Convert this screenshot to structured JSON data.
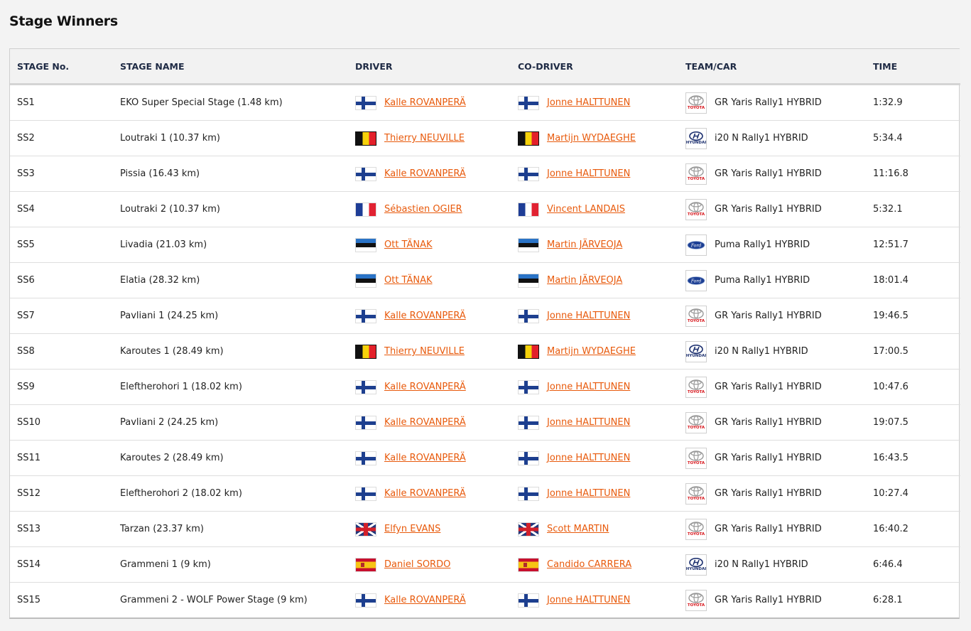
{
  "page": {
    "title": "Stage Winners"
  },
  "table": {
    "headers": [
      "STAGE No.",
      "STAGE NAME",
      "DRIVER",
      "CO-DRIVER",
      "TEAM/CAR",
      "TIME"
    ],
    "rows": [
      {
        "stage": "SS1",
        "name": "EKO Super Special Stage (1.48 km)",
        "driver": "Kalle ROVANPERÄ",
        "driver_flag": "fi",
        "codriver": "Jonne HALTTUNEN",
        "codriver_flag": "fi",
        "team_logo": "toyota",
        "logo_text": "TOYOTA",
        "car": "GR Yaris Rally1 HYBRID",
        "time": "1:32.9"
      },
      {
        "stage": "SS2",
        "name": "Loutraki 1 (10.37 km)",
        "driver": "Thierry NEUVILLE",
        "driver_flag": "be",
        "codriver": "Martijn WYDAEGHE",
        "codriver_flag": "be",
        "team_logo": "hyundai",
        "logo_text": "HYUNDAI",
        "car": "i20 N Rally1 HYBRID",
        "time": "5:34.4"
      },
      {
        "stage": "SS3",
        "name": "Pissia (16.43 km)",
        "driver": "Kalle ROVANPERÄ",
        "driver_flag": "fi",
        "codriver": "Jonne HALTTUNEN",
        "codriver_flag": "fi",
        "team_logo": "toyota",
        "logo_text": "TOYOTA",
        "car": "GR Yaris Rally1 HYBRID",
        "time": "11:16.8"
      },
      {
        "stage": "SS4",
        "name": "Loutraki 2 (10.37 km)",
        "driver": "Sébastien OGIER",
        "driver_flag": "fr",
        "codriver": "Vincent LANDAIS",
        "codriver_flag": "fr",
        "team_logo": "toyota",
        "logo_text": "TOYOTA",
        "car": "GR Yaris Rally1 HYBRID",
        "time": "5:32.1"
      },
      {
        "stage": "SS5",
        "name": "Livadia (21.03 km)",
        "driver": "Ott TÄNAK",
        "driver_flag": "ee",
        "codriver": "Martin JÄRVEOJA",
        "codriver_flag": "ee",
        "team_logo": "ford",
        "logo_text": "Ford",
        "car": "Puma Rally1 HYBRID",
        "time": "12:51.7"
      },
      {
        "stage": "SS6",
        "name": "Elatia (28.32 km)",
        "driver": "Ott TÄNAK",
        "driver_flag": "ee",
        "codriver": "Martin JÄRVEOJA",
        "codriver_flag": "ee",
        "team_logo": "ford",
        "logo_text": "Ford",
        "car": "Puma Rally1 HYBRID",
        "time": "18:01.4"
      },
      {
        "stage": "SS7",
        "name": "Pavliani 1 (24.25 km)",
        "driver": "Kalle ROVANPERÄ",
        "driver_flag": "fi",
        "codriver": "Jonne HALTTUNEN",
        "codriver_flag": "fi",
        "team_logo": "toyota",
        "logo_text": "TOYOTA",
        "car": "GR Yaris Rally1 HYBRID",
        "time": "19:46.5"
      },
      {
        "stage": "SS8",
        "name": "Karoutes 1 (28.49 km)",
        "driver": "Thierry NEUVILLE",
        "driver_flag": "be",
        "codriver": "Martijn WYDAEGHE",
        "codriver_flag": "be",
        "team_logo": "hyundai",
        "logo_text": "HYUNDAI",
        "car": "i20 N Rally1 HYBRID",
        "time": "17:00.5"
      },
      {
        "stage": "SS9",
        "name": "Eleftherohori 1 (18.02 km)",
        "driver": "Kalle ROVANPERÄ",
        "driver_flag": "fi",
        "codriver": "Jonne HALTTUNEN",
        "codriver_flag": "fi",
        "team_logo": "toyota",
        "logo_text": "TOYOTA",
        "car": "GR Yaris Rally1 HYBRID",
        "time": "10:47.6"
      },
      {
        "stage": "SS10",
        "name": "Pavliani 2 (24.25 km)",
        "driver": "Kalle ROVANPERÄ",
        "driver_flag": "fi",
        "codriver": "Jonne HALTTUNEN",
        "codriver_flag": "fi",
        "team_logo": "toyota",
        "logo_text": "TOYOTA",
        "car": "GR Yaris Rally1 HYBRID",
        "time": "19:07.5"
      },
      {
        "stage": "SS11",
        "name": "Karoutes 2 (28.49 km)",
        "driver": "Kalle ROVANPERÄ",
        "driver_flag": "fi",
        "codriver": "Jonne HALTTUNEN",
        "codriver_flag": "fi",
        "team_logo": "toyota",
        "logo_text": "TOYOTA",
        "car": "GR Yaris Rally1 HYBRID",
        "time": "16:43.5"
      },
      {
        "stage": "SS12",
        "name": "Eleftherohori 2 (18.02 km)",
        "driver": "Kalle ROVANPERÄ",
        "driver_flag": "fi",
        "codriver": "Jonne HALTTUNEN",
        "codriver_flag": "fi",
        "team_logo": "toyota",
        "logo_text": "TOYOTA",
        "car": "GR Yaris Rally1 HYBRID",
        "time": "10:27.4"
      },
      {
        "stage": "SS13",
        "name": "Tarzan (23.37 km)",
        "driver": "Elfyn EVANS",
        "driver_flag": "gb",
        "codriver": "Scott MARTIN",
        "codriver_flag": "gb",
        "team_logo": "toyota",
        "logo_text": "TOYOTA",
        "car": "GR Yaris Rally1 HYBRID",
        "time": "16:40.2"
      },
      {
        "stage": "SS14",
        "name": "Grammeni 1 (9 km)",
        "driver": "Daniel SORDO",
        "driver_flag": "es",
        "codriver": "Candido CARRERA",
        "codriver_flag": "es",
        "team_logo": "hyundai",
        "logo_text": "HYUNDAI",
        "car": "i20 N Rally1 HYBRID",
        "time": "6:46.4"
      },
      {
        "stage": "SS15",
        "name": "Grammeni 2 - WOLF Power Stage (9 km)",
        "driver": "Kalle ROVANPERÄ",
        "driver_flag": "fi",
        "codriver": "Jonne HALTTUNEN",
        "codriver_flag": "fi",
        "team_logo": "toyota",
        "logo_text": "TOYOTA",
        "car": "GR Yaris Rally1 HYBRID",
        "time": "6:28.1"
      }
    ]
  },
  "colors": {
    "link": "#e85a0c",
    "header_bg": "#f2f2f2",
    "page_bg": "#f3f3f3",
    "header_text": "#1e2a44"
  }
}
